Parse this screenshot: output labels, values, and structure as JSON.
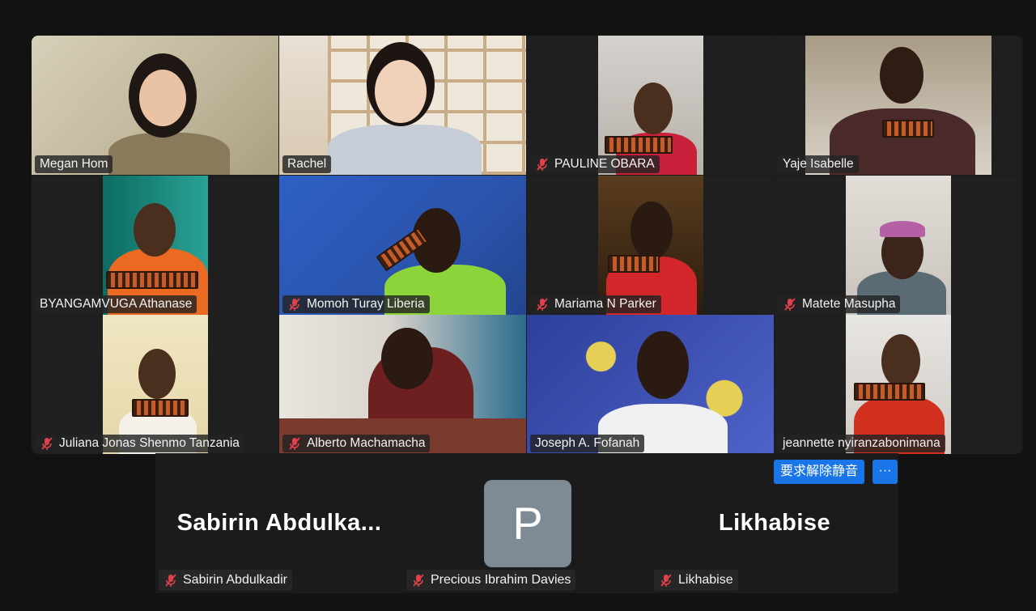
{
  "participants": [
    {
      "name": "Megan Hom",
      "muted": false
    },
    {
      "name": "Rachel",
      "muted": false,
      "active_speaker": true
    },
    {
      "name": "PAULINE OBARA",
      "muted": true
    },
    {
      "name": "Yaje Isabelle",
      "muted": false
    },
    {
      "name": "BYANGAMVUGA Athanase",
      "muted": false
    },
    {
      "name": "Momoh Turay Liberia",
      "muted": true
    },
    {
      "name": "Mariama N Parker",
      "muted": true
    },
    {
      "name": "Matete Masupha",
      "muted": true
    },
    {
      "name": "Juliana Jonas Shenmo Tanzania",
      "muted": true
    },
    {
      "name": "Alberto Machamacha",
      "muted": true
    },
    {
      "name": "Joseph A. Fofanah",
      "muted": false
    },
    {
      "name": "jeannette nyiranzabonimana",
      "muted": false
    }
  ],
  "video_off": [
    {
      "display_name": "Sabirin  Abdulka...",
      "label": "Sabirin Abdulkadir",
      "muted": true
    },
    {
      "avatar_letter": "P",
      "label": "Precious Ibrahim Davies",
      "muted": true
    },
    {
      "display_name": "Likhabise",
      "label": "Likhabise",
      "muted": true
    }
  ],
  "controls": {
    "request_unmute_label": "要求解除静音",
    "more_label": "···"
  },
  "colors": {
    "active_speaker_border": "#2fd27a",
    "button_blue": "#1a75e8",
    "muted_icon": "#e0404a",
    "avatar_bg": "#7e8b95"
  },
  "icons": {
    "muted": "microphone-muted-icon",
    "more": "ellipsis-icon"
  }
}
